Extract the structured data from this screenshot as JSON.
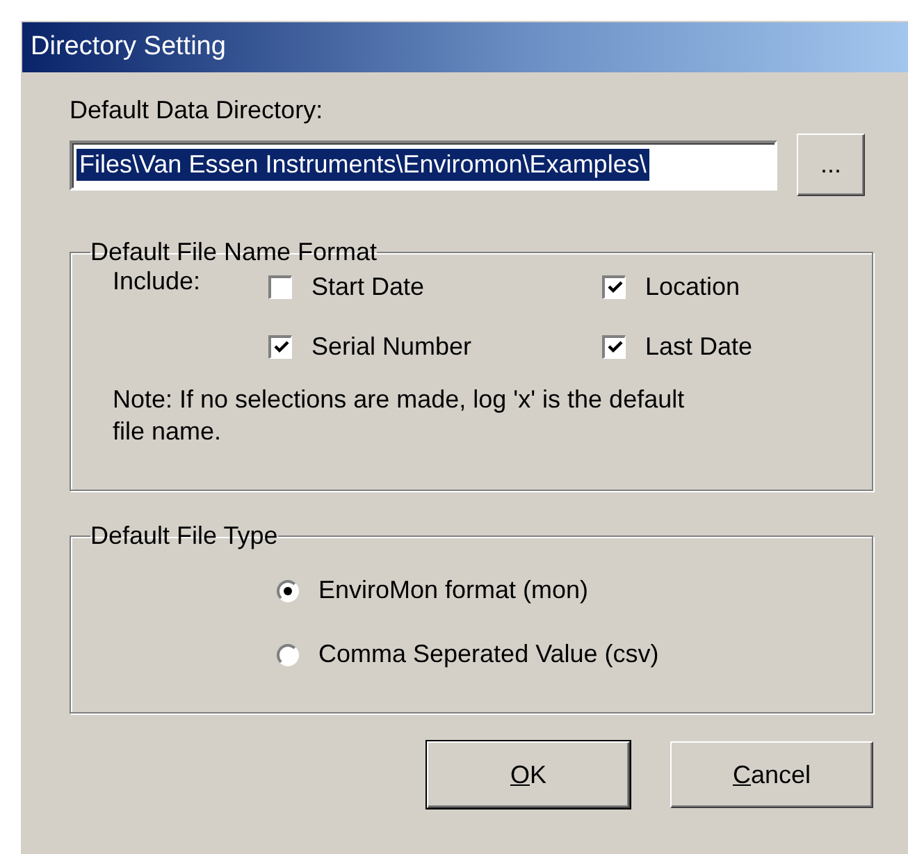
{
  "window": {
    "title": "Directory Setting"
  },
  "directory": {
    "label": "Default Data Directory:",
    "value": "Files\\Van Essen Instruments\\Enviromon\\Examples\\",
    "text_selected": true,
    "browse_label": "..."
  },
  "file_name_format": {
    "title": "Default File Name Format",
    "include_label": "Include:",
    "options": [
      {
        "label": "Start Date",
        "checked": false
      },
      {
        "label": "Location",
        "checked": true
      },
      {
        "label": "Serial Number",
        "checked": true
      },
      {
        "label": "Last Date",
        "checked": true
      }
    ],
    "note": "Note: If no selections are made, log 'x' is the default file name."
  },
  "file_type": {
    "title": "Default File Type",
    "options": [
      {
        "label": "EnviroMon format (mon)",
        "selected": true
      },
      {
        "label": "Comma Seperated Value (csv)",
        "selected": false
      }
    ]
  },
  "buttons": [
    {
      "mnemonic": "O",
      "rest": "K",
      "default": true
    },
    {
      "mnemonic": "C",
      "rest": "ancel",
      "default": false
    }
  ]
}
